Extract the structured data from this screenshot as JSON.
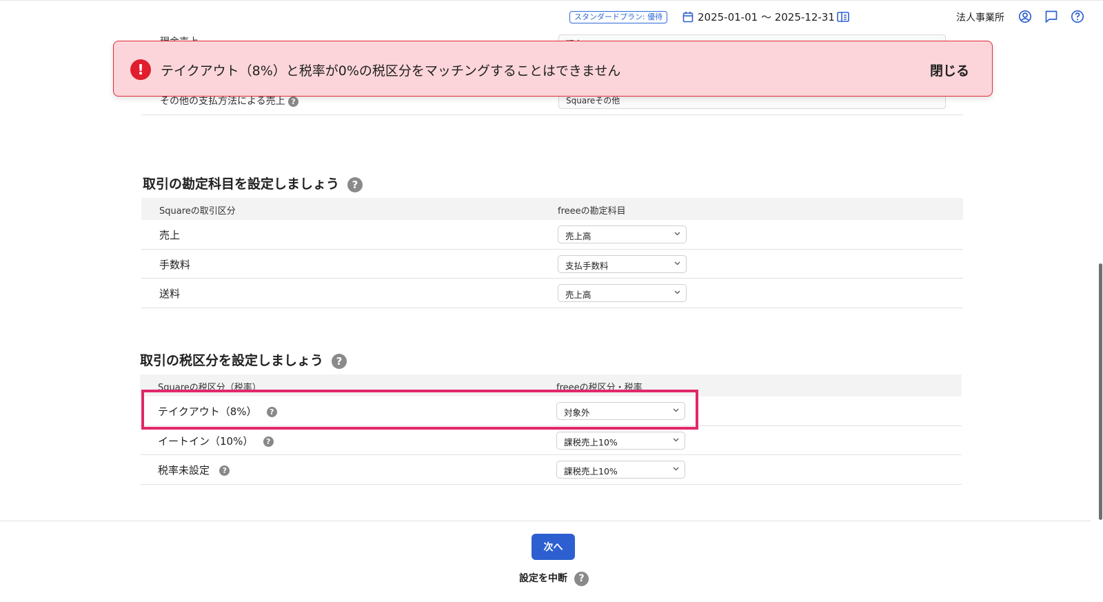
{
  "header": {
    "plan_badge": "スタンダードプラン: 優待",
    "period": "2025-01-01 〜 2025-12-31",
    "office": "法人事業所"
  },
  "background_rows": {
    "cash_sales_label": "現金売上",
    "cash_sales_value": "現金",
    "other_payment_label": "その他の支払方法による売上",
    "other_payment_value": "Squareその他"
  },
  "toast": {
    "message": "テイクアウト（8%）と税率が0%の税区分をマッチングすることはできません",
    "close_label": "閉じる"
  },
  "accounts_section": {
    "title": "取引の勘定科目を設定しましょう",
    "col_square": "Squareの取引区分",
    "col_freee": "freeeの勘定科目",
    "rows": [
      {
        "label": "売上",
        "value": "売上高"
      },
      {
        "label": "手数料",
        "value": "支払手数料"
      },
      {
        "label": "送料",
        "value": "売上高"
      }
    ]
  },
  "tax_section": {
    "title": "取引の税区分を設定しましょう",
    "col_square": "Squareの税区分（税率）",
    "col_freee": "freeeの税区分・税率",
    "rows": [
      {
        "label": "テイクアウト（8%）",
        "value": "対象外"
      },
      {
        "label": "イートイン（10%）",
        "value": "課税売上10%"
      },
      {
        "label": "税率未設定",
        "value": "課税売上10%"
      }
    ]
  },
  "footer": {
    "next_label": "次へ",
    "abort_label": "設定を中断"
  },
  "icons": {
    "help": "?",
    "alert": "!"
  },
  "colors": {
    "accent": "#2d5fd0",
    "error": "#e01e2e",
    "toast_bg": "#fbd5d9",
    "highlight": "#e0286a"
  }
}
